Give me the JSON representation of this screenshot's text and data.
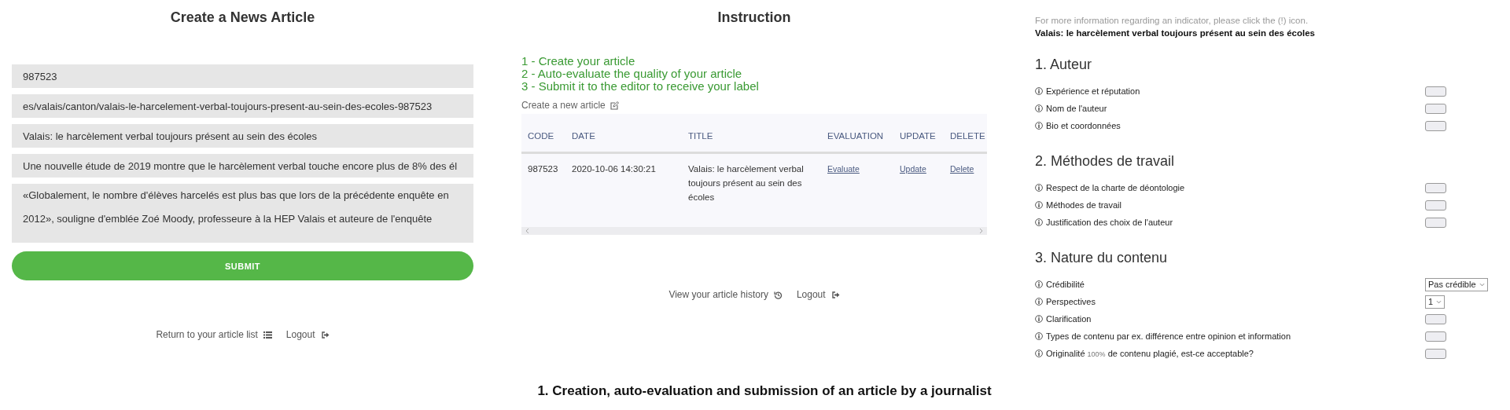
{
  "create_panel": {
    "title": "Create a News Article",
    "fields": [
      {
        "kind": "input",
        "value": "987523"
      },
      {
        "kind": "input",
        "value": "es/valais/canton/valais-le-harcelement-verbal-toujours-present-au-sein-des-ecoles-987523"
      },
      {
        "kind": "input",
        "value": "Valais: le harcèlement verbal toujours présent au sein des écoles"
      },
      {
        "kind": "input",
        "value": "Une nouvelle étude de 2019 montre que le harcèlement verbal touche encore plus de 8% des él"
      },
      {
        "kind": "textarea",
        "value": "«Globalement, le nombre d'élèves harcelés est plus bas que lors de la précédente enquête en 2012», souligne d'emblée Zoé Moody, professeure à la HEP Valais et auteure de l'enquête"
      }
    ],
    "submit": "SUBMIT",
    "links": [
      {
        "kind": "list",
        "label": "Return to your article list"
      },
      {
        "kind": "logout",
        "label": "Logout"
      }
    ]
  },
  "instruction_panel": {
    "title": "Instruction",
    "steps": [
      "1 - Create your article",
      "2 - Auto-evaluate the quality of your article",
      "3 - Submit it to the editor to receive your label"
    ],
    "new_article": "Create a new article",
    "table": {
      "columns": [
        "CODE",
        "DATE",
        "TITLE",
        "EVALUATION",
        "UPDATE",
        "DELETE"
      ],
      "rows": [
        {
          "code": "987523",
          "date": "2020-10-06 14:30:21",
          "title": "Valais: le harcèlement verbal toujours présent au sein des écoles",
          "evaluation": "Evaluate",
          "update": "Update",
          "delete": "Delete"
        }
      ]
    },
    "links": [
      {
        "kind": "history",
        "label": "View your article history"
      },
      {
        "kind": "logout",
        "label": "Logout"
      }
    ]
  },
  "evaluation_panel": {
    "info": "For more information regarding an indicator, please click the (!) icon.",
    "article_title": "Valais: le harcèlement verbal toujours présent au sein des écoles",
    "sections": [
      {
        "heading": "1. Auteur",
        "indicators": [
          {
            "kind": "field",
            "label": "Expérience et réputation"
          },
          {
            "kind": "field",
            "label": "Nom de l'auteur"
          },
          {
            "kind": "field",
            "label": "Bio et coordonnées"
          }
        ]
      },
      {
        "heading": "2. Méthodes de travail",
        "indicators": [
          {
            "kind": "field",
            "label": "Respect de la charte de déontologie"
          },
          {
            "kind": "field",
            "label": "Méthodes de travail"
          },
          {
            "kind": "field",
            "label": "Justification des choix de l'auteur"
          }
        ]
      },
      {
        "heading": "3. Nature du contenu",
        "indicators": [
          {
            "kind": "select",
            "label": "Crédibilité",
            "value": "Pas crédible"
          },
          {
            "kind": "select",
            "label": "Perspectives",
            "value": "1"
          },
          {
            "kind": "field",
            "label": "Clarification"
          },
          {
            "kind": "field",
            "label": "Types de contenu par ex. différence entre opinion et information"
          },
          {
            "kind": "field",
            "label": "Originalité",
            "note": "100%",
            "rest": "de contenu plagié, est-ce acceptable?"
          }
        ]
      }
    ]
  },
  "caption": "1. Creation, auto-evaluation and submission of an article by a journalist"
}
